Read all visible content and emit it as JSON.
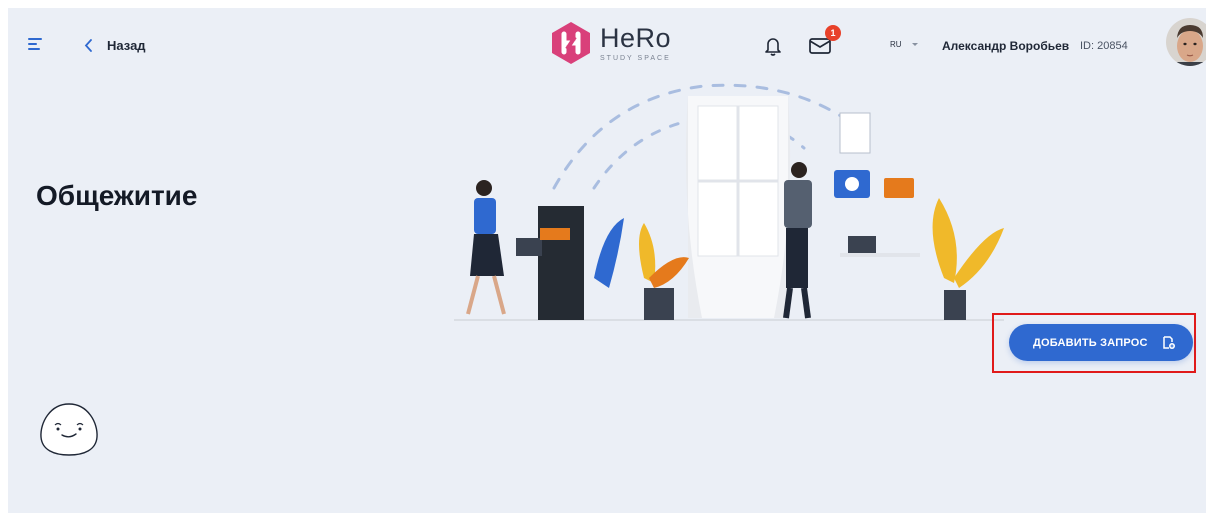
{
  "header": {
    "back_label": "Назад",
    "logo": {
      "title": "HeRo",
      "subtitle": "STUDY SPACE"
    },
    "mail_badge_count": "1",
    "language": "RU",
    "user_name": "Александр Воробьев",
    "user_id": "ID: 20854"
  },
  "page": {
    "title": "Общежитие"
  },
  "actions": {
    "add_request_label": "ДОБАВИТЬ ЗАПРОС"
  },
  "icons": [
    "menu-icon",
    "chevron-left-icon",
    "bell-icon",
    "mail-icon",
    "caret-down-icon",
    "add-document-icon",
    "empty-face-icon"
  ],
  "colors": {
    "background": "#ebeff6",
    "primary": "#2f69d0",
    "badge": "#e8412a",
    "logo": "#d9407a",
    "highlight": "#e01a1a"
  }
}
